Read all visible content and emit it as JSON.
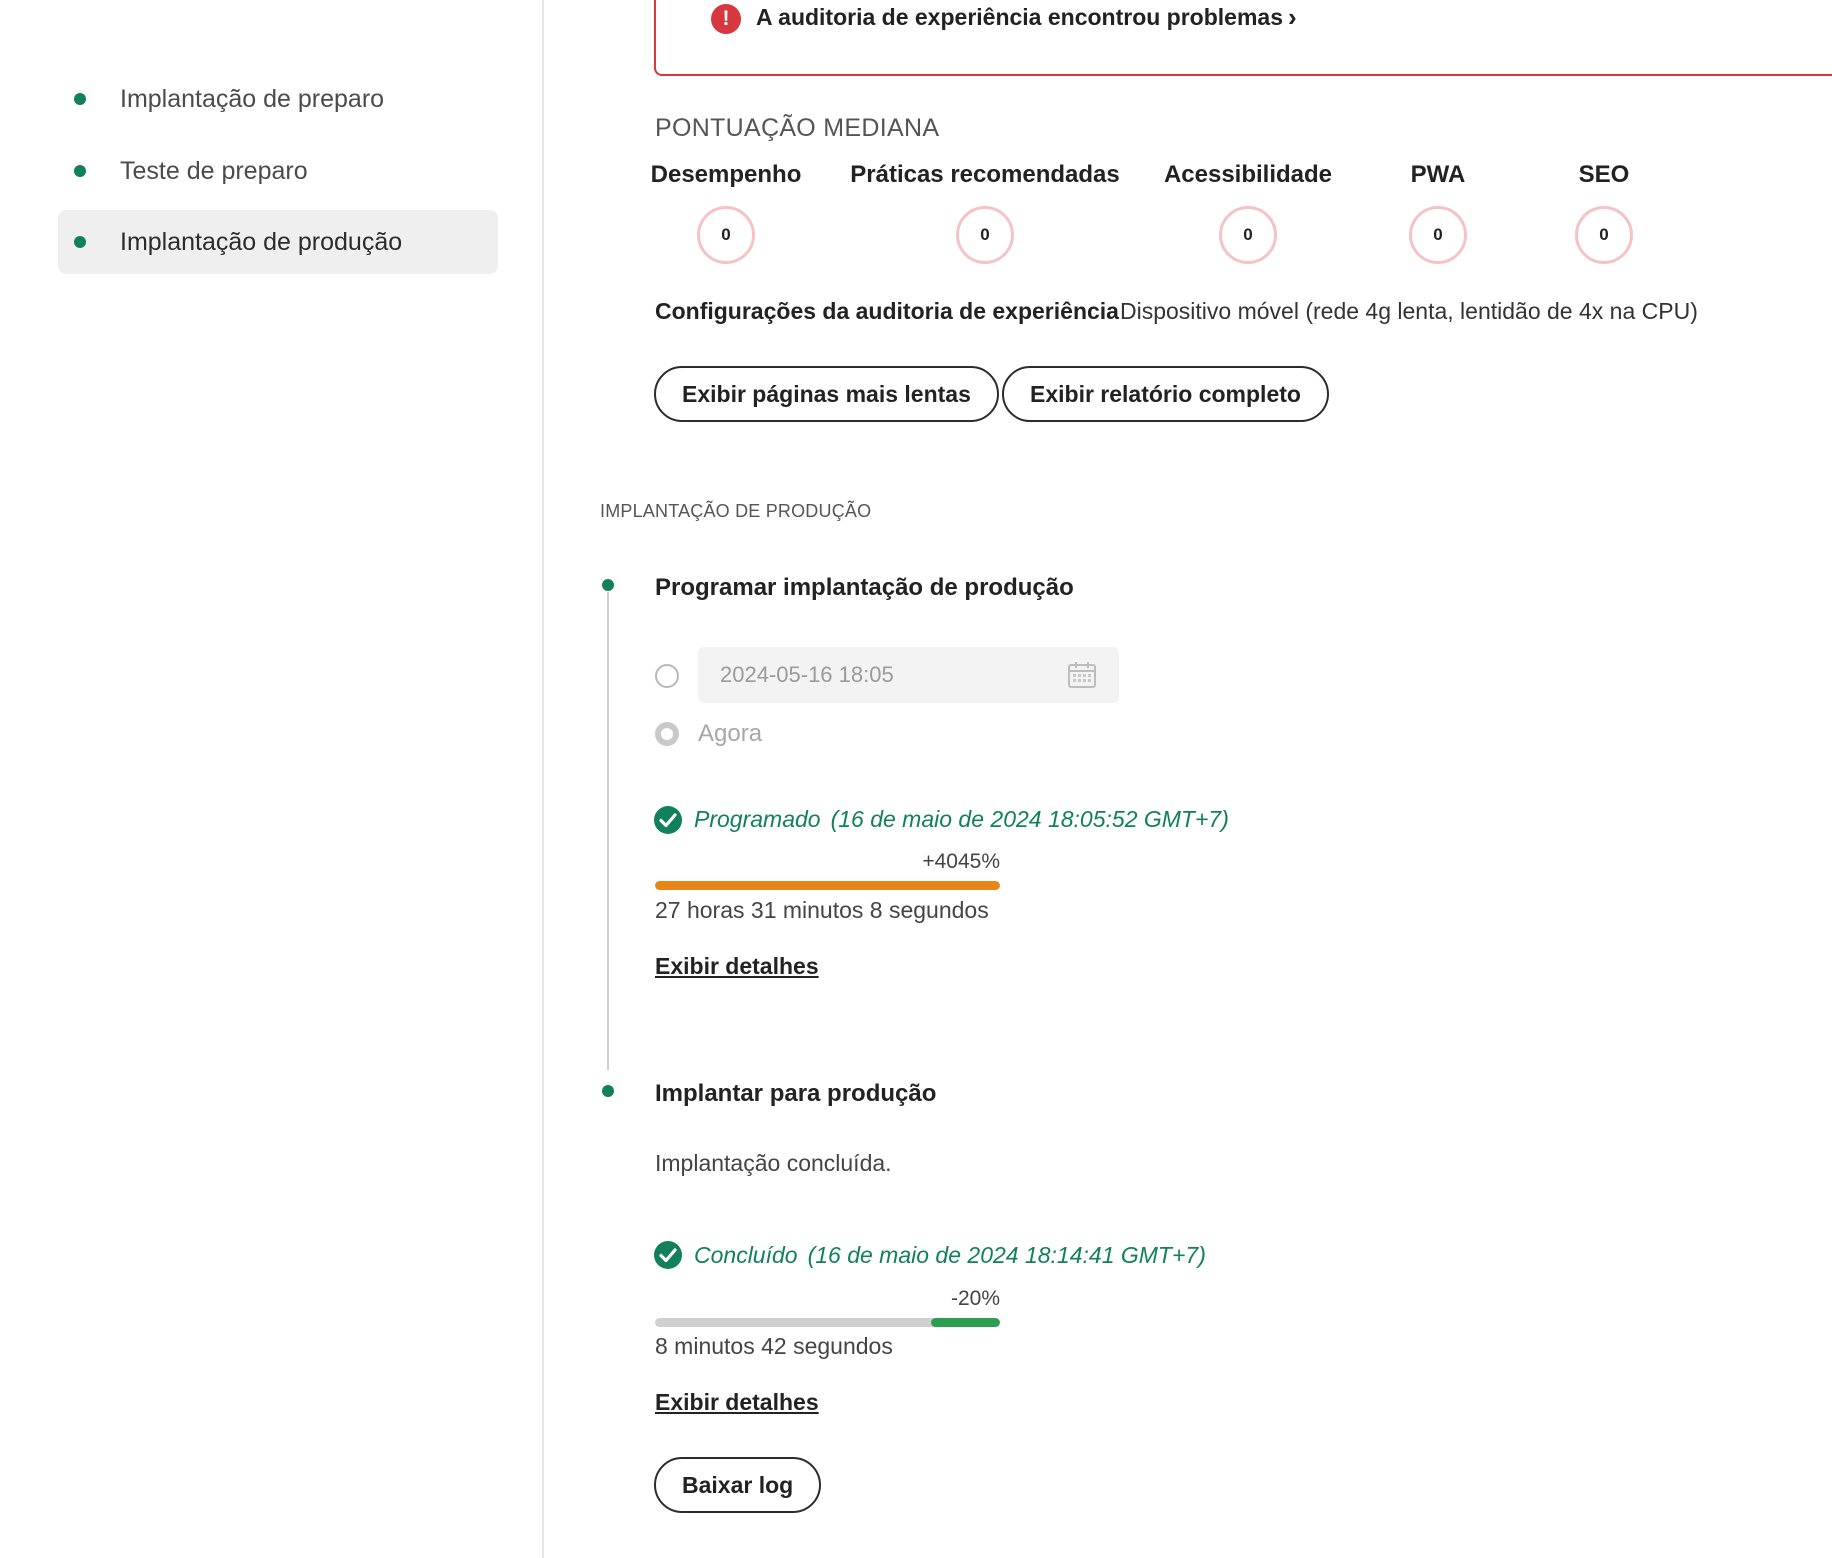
{
  "sidebar": {
    "items": [
      {
        "label": "Implantação de preparo",
        "active": false
      },
      {
        "label": "Teste de preparo",
        "active": false
      },
      {
        "label": "Implantação de produção",
        "active": true
      }
    ]
  },
  "alert": {
    "icon": "error-icon",
    "text": "A auditoria de experiência encontrou problemas",
    "chevron": "›"
  },
  "scores": {
    "heading": "PONTUAÇÃO MEDIANA",
    "metrics": [
      {
        "label": "Desempenho",
        "value": "0"
      },
      {
        "label": "Práticas recomendadas",
        "value": "0"
      },
      {
        "label": "Acessibilidade",
        "value": "0"
      },
      {
        "label": "PWA",
        "value": "0"
      },
      {
        "label": "SEO",
        "value": "0"
      }
    ]
  },
  "config": {
    "label": "Configurações da auditoria de experiência",
    "value": "Dispositivo móvel (rede 4g lenta, lentidão de 4x na CPU)"
  },
  "buttons": {
    "slowest_pages": "Exibir páginas mais lentas",
    "full_report": "Exibir relatório completo",
    "download_log": "Baixar log"
  },
  "production": {
    "heading": "IMPLANTAÇÃO DE PRODUÇÃO",
    "schedule": {
      "title": "Programar implantação de produção",
      "date_value": "2024-05-16 18:05",
      "now_label": "Agora",
      "status": "Programado",
      "status_date": "(16 de maio de 2024 18:05:52 GMT+7)",
      "change": "+4045%",
      "progress_fraction": 1.0,
      "bar_color": "#e68619",
      "duration": "27 horas 31 minutos 8 segundos",
      "details_link": "Exibir detalhes"
    },
    "deploy": {
      "title": "Implantar para produção",
      "message": "Implantação concluída.",
      "status": "Concluído",
      "status_date": "(16 de maio de 2024 18:14:41 GMT+7)",
      "change": "-20%",
      "baseline_fraction": 0.8,
      "bar_color": "#2d9d4f",
      "duration": "8 minutos 42 segundos",
      "details_link": "Exibir detalhes"
    }
  },
  "colors": {
    "accent_green": "#12805c",
    "error_red": "#d7373f",
    "score_ring": "#f5c3c5"
  }
}
